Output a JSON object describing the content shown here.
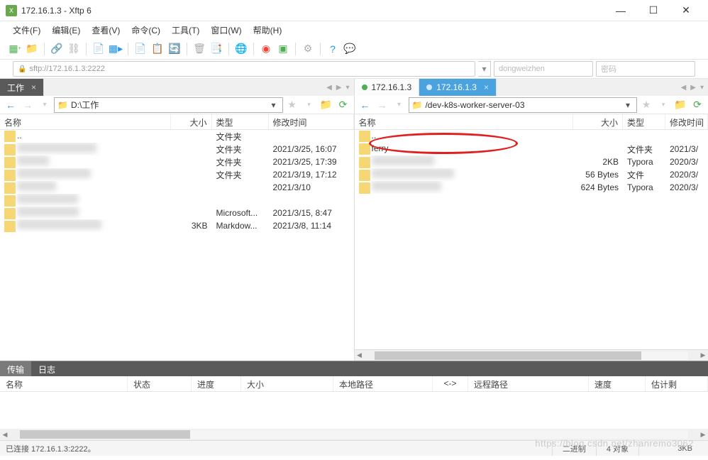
{
  "window": {
    "title": "172.16.1.3    - Xftp 6",
    "app_icon_label": "X"
  },
  "menu": {
    "file": "文件(F)",
    "edit": "编辑(E)",
    "view": "查看(V)",
    "cmd": "命令(C)",
    "tools": "工具(T)",
    "window": "窗口(W)",
    "help": "帮助(H)"
  },
  "address": {
    "url": "sftp://172.16.1.3:2222",
    "user_placeholder": "dongweizhen",
    "pass_placeholder": "密码"
  },
  "local": {
    "tab_label": "工作",
    "path": "D:\\工作",
    "hdr": {
      "name": "名称",
      "size": "大小",
      "type": "类型",
      "mtime": "修改时间"
    },
    "rows": [
      {
        "name": "..",
        "size": "",
        "type": "文件夹",
        "mtime": ""
      },
      {
        "name": "",
        "size": "",
        "type": "文件夹",
        "mtime": "2021/3/25, 16:07"
      },
      {
        "name": "",
        "size": "",
        "type": "文件夹",
        "mtime": "2021/3/25, 17:39"
      },
      {
        "name": "",
        "size": "",
        "type": "文件夹",
        "mtime": "2021/3/19, 17:12"
      },
      {
        "name": "",
        "size": "",
        "type": "",
        "mtime": "2021/3/10"
      },
      {
        "name": "",
        "size": "",
        "type": "",
        "mtime": ""
      },
      {
        "name": "",
        "size": "",
        "type": "Microsoft...",
        "mtime": "2021/3/15, 8:47"
      },
      {
        "name": "",
        "size": "3KB",
        "type": "Markdow...",
        "mtime": "2021/3/8, 11:14"
      }
    ]
  },
  "remote": {
    "tab1_label": "172.16.1.3",
    "tab2_label": "172.16.1.3",
    "path": "/dev-k8s-worker-server-03",
    "hdr": {
      "name": "名称",
      "size": "大小",
      "type": "类型",
      "mtime": "修改时间"
    },
    "rows": [
      {
        "name": "..",
        "size": "",
        "type": "",
        "mtime": ""
      },
      {
        "name": "ferry",
        "size": "",
        "type": "文件夹",
        "mtime": "2021/3/"
      },
      {
        "name": "",
        "size": "2KB",
        "type": "Typora",
        "mtime": "2020/3/"
      },
      {
        "name": "",
        "size": "56 Bytes",
        "type": "文件",
        "mtime": "2020/3/"
      },
      {
        "name": "",
        "size": "624 Bytes",
        "type": "Typora",
        "mtime": "2020/3/"
      }
    ]
  },
  "bottom": {
    "tab_transfer": "传输",
    "tab_log": "日志",
    "hdr": {
      "name": "名称",
      "status": "状态",
      "progress": "进度",
      "size": "大小",
      "localpath": "本地路径",
      "arrow": "<->",
      "remotepath": "远程路径",
      "speed": "速度",
      "eta": "估计剩"
    }
  },
  "status": {
    "connected": "已连接 172.16.1.3:2222。",
    "mode": "二进制",
    "objects": "4 对象",
    "size": "3KB"
  },
  "watermark": "https://blog.csdn.net/zhanremo3062"
}
